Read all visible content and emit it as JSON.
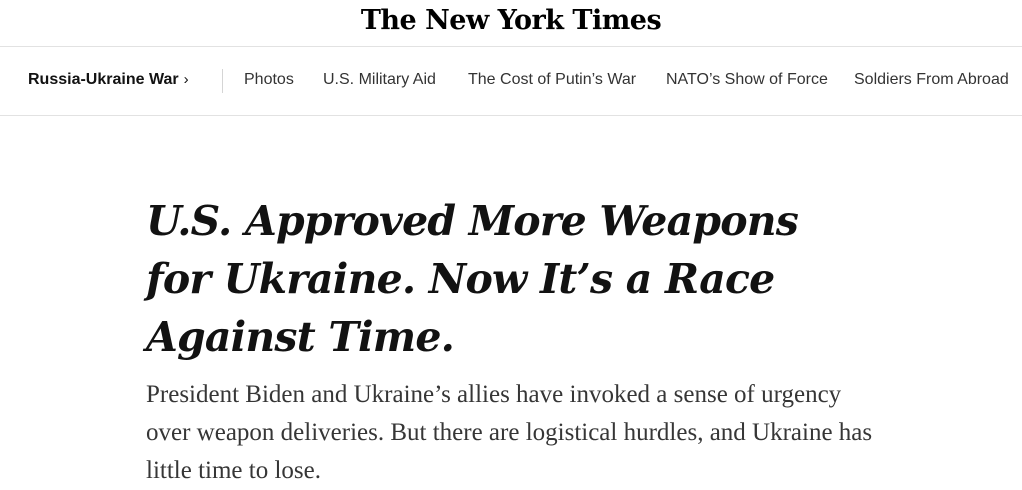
{
  "masthead": {
    "logo_text": "The New York Times"
  },
  "section_nav": {
    "section_label": "Russia-Ukraine War",
    "section_chevron": "›",
    "links": [
      {
        "label": "Photos"
      },
      {
        "label": "U.S. Military Aid"
      },
      {
        "label": "The Cost of Putin’s War"
      },
      {
        "label": "NATO’s Show of Force"
      },
      {
        "label": "Soldiers From Abroad"
      }
    ]
  },
  "article": {
    "headline": "U.S. Approved More Weapons for Ukraine. Now It’s a Race Against Time.",
    "summary": "President Biden and Ukraine’s allies have invoked a sense of urgency over weapon deliveries. But there are logistical hurdles, and Ukraine has little time to lose."
  }
}
